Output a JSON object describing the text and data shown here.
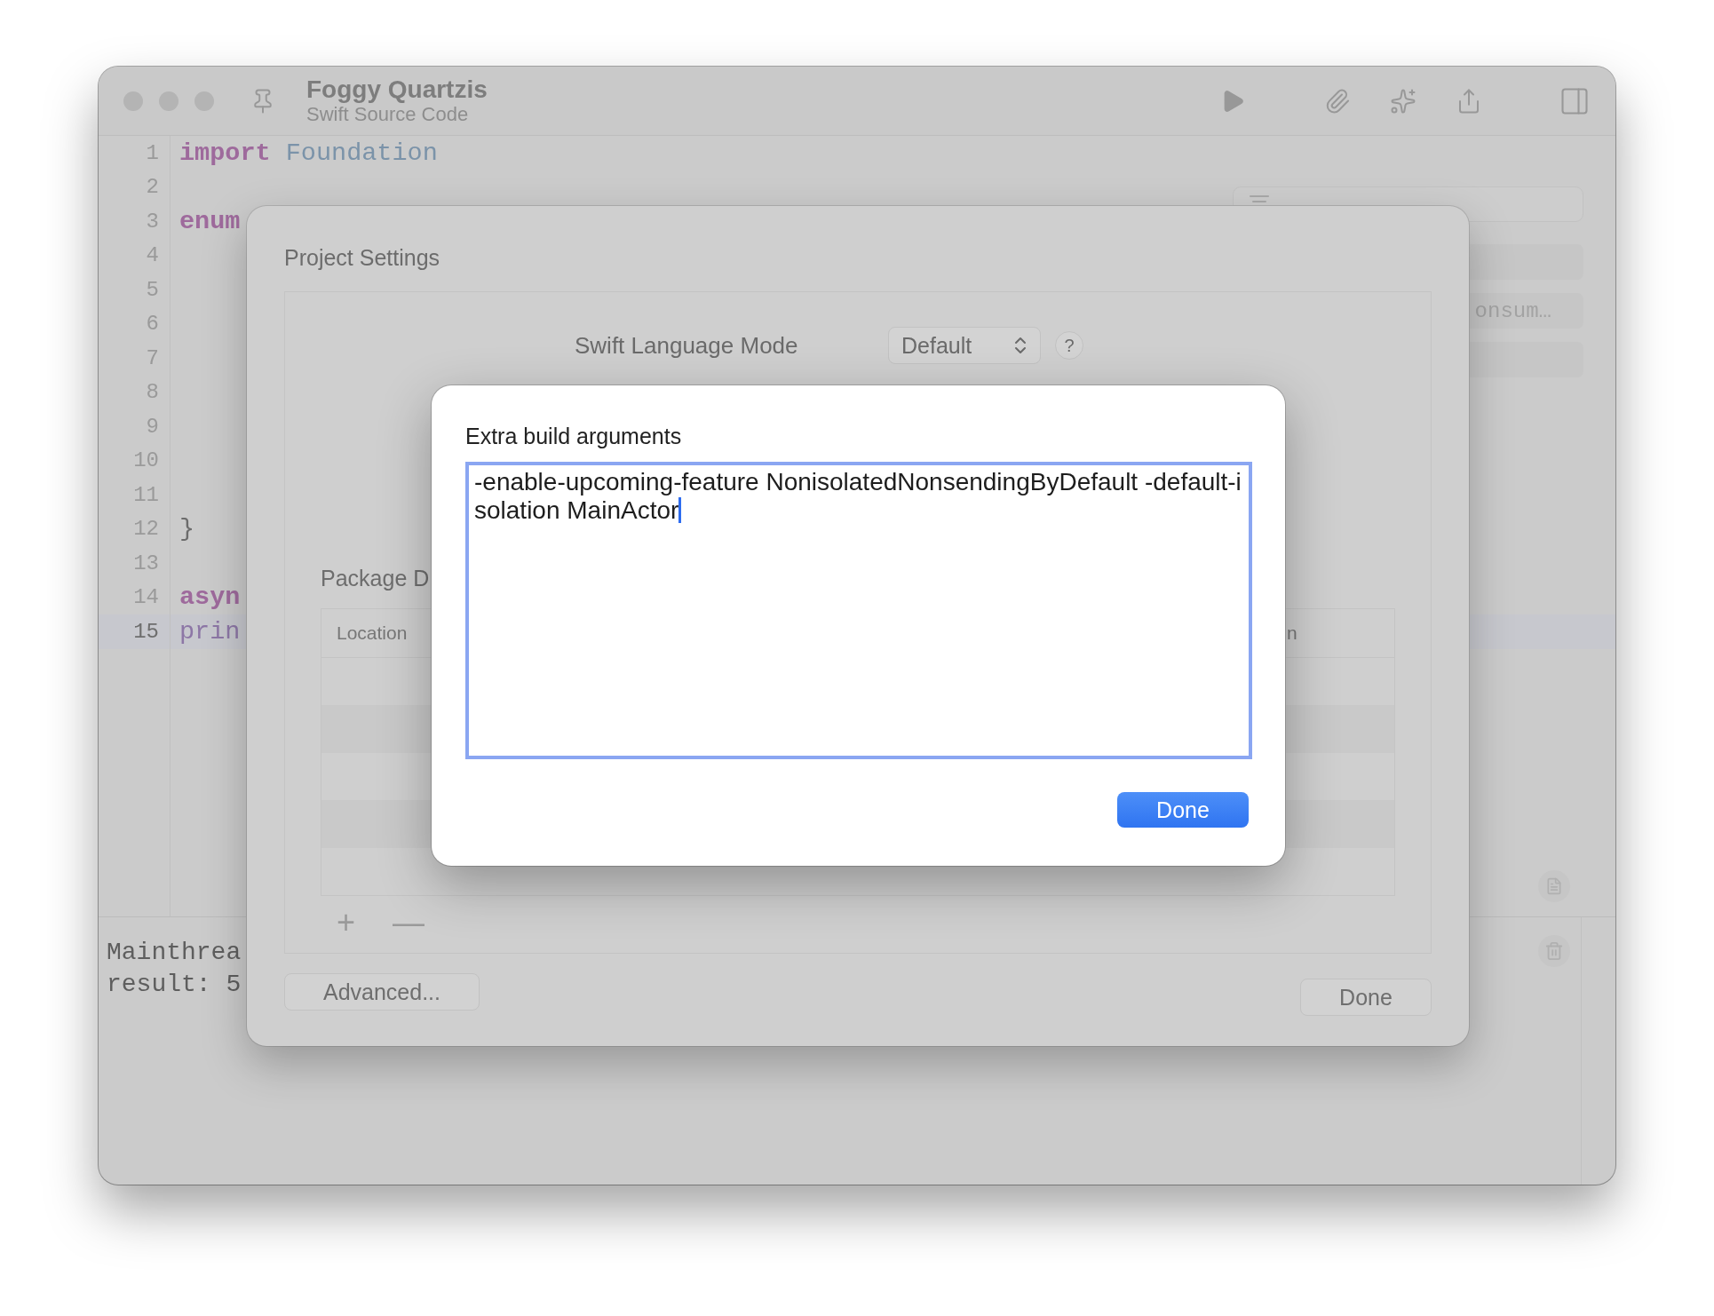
{
  "window": {
    "title": "Foggy Quartzis",
    "subtitle": "Swift Source Code"
  },
  "editor": {
    "lines": [
      {
        "number": "1",
        "current": false,
        "tokens": [
          {
            "kind": "keyword",
            "text": "import"
          },
          {
            "kind": "type",
            "text": "Foundation"
          }
        ]
      },
      {
        "number": "2",
        "current": false
      },
      {
        "number": "3",
        "current": false,
        "tokens": [
          {
            "kind": "keyword",
            "text": "enum"
          }
        ]
      },
      {
        "number": "4",
        "current": false
      },
      {
        "number": "5",
        "current": false
      },
      {
        "number": "6",
        "current": false
      },
      {
        "number": "7",
        "current": false
      },
      {
        "number": "8",
        "current": false
      },
      {
        "number": "9",
        "current": false
      },
      {
        "number": "10",
        "current": false
      },
      {
        "number": "11",
        "current": false
      },
      {
        "number": "12",
        "current": false,
        "tokens": [
          {
            "kind": "plain",
            "text": "}"
          }
        ]
      },
      {
        "number": "13",
        "current": false
      },
      {
        "number": "14",
        "current": false,
        "tokens": [
          {
            "kind": "keyword",
            "text": "asyn"
          }
        ]
      },
      {
        "number": "15",
        "current": true,
        "tokens": [
          {
            "kind": "call",
            "text": "prin"
          }
        ]
      }
    ]
  },
  "symbols": {
    "items": [
      {
        "kind": "blank"
      },
      {
        "kind": "text",
        "label": "onsum…"
      },
      {
        "kind": "blank"
      }
    ]
  },
  "console": {
    "lines": [
      "Mainthrea",
      "result: 5"
    ]
  },
  "sheet": {
    "title": "Project Settings",
    "language_mode": {
      "label": "Swift Language Mode",
      "value": "Default",
      "help": "?"
    },
    "packages": {
      "heading": "Package D",
      "columns": [
        "Location",
        "n"
      ],
      "rows": [
        {
          "kind": "blank"
        },
        {
          "kind": "blank"
        },
        {
          "kind": "blank"
        },
        {
          "kind": "blank"
        },
        {
          "kind": "blank"
        }
      ],
      "add": "+",
      "remove": "—"
    },
    "advanced_button": "Advanced...",
    "done_button": "Done"
  },
  "dialog": {
    "title": "Extra build arguments",
    "value": "-enable-upcoming-feature NonisolatedNonsendingByDefault -default-isolation MainActor",
    "focused": true,
    "done_button": "Done"
  }
}
